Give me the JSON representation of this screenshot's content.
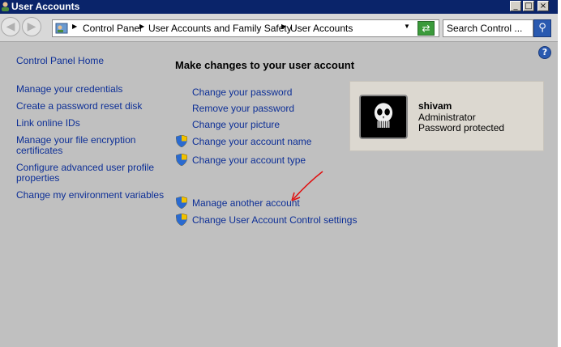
{
  "window": {
    "title": "User Accounts",
    "min": "_",
    "max": "□",
    "close": "×"
  },
  "address": {
    "segments": [
      "Control Panel",
      "User Accounts and Family Safety",
      "User Accounts"
    ]
  },
  "search": {
    "placeholder": "Search Control ..."
  },
  "sidebar": {
    "home": "Control Panel Home",
    "items": [
      "Manage your credentials",
      "Create a password reset disk",
      "Link online IDs",
      "Manage your file encryption",
      "certificates",
      "Configure advanced user profile",
      "properties",
      "Change my environment variables"
    ]
  },
  "main": {
    "heading": "Make changes to your user account",
    "links": [
      "Change your password",
      "Remove your password",
      "Change your picture",
      "Change your account name",
      "Change your account type",
      "Manage another account",
      "Change User Account Control settings"
    ]
  },
  "user": {
    "name": "shivam",
    "role": "Administrator",
    "status": "Password protected"
  },
  "colors": {
    "link": "#0c2e96",
    "titlebar": "#0a246a",
    "background": "#c0c0c0",
    "arrow": "#e01010"
  }
}
